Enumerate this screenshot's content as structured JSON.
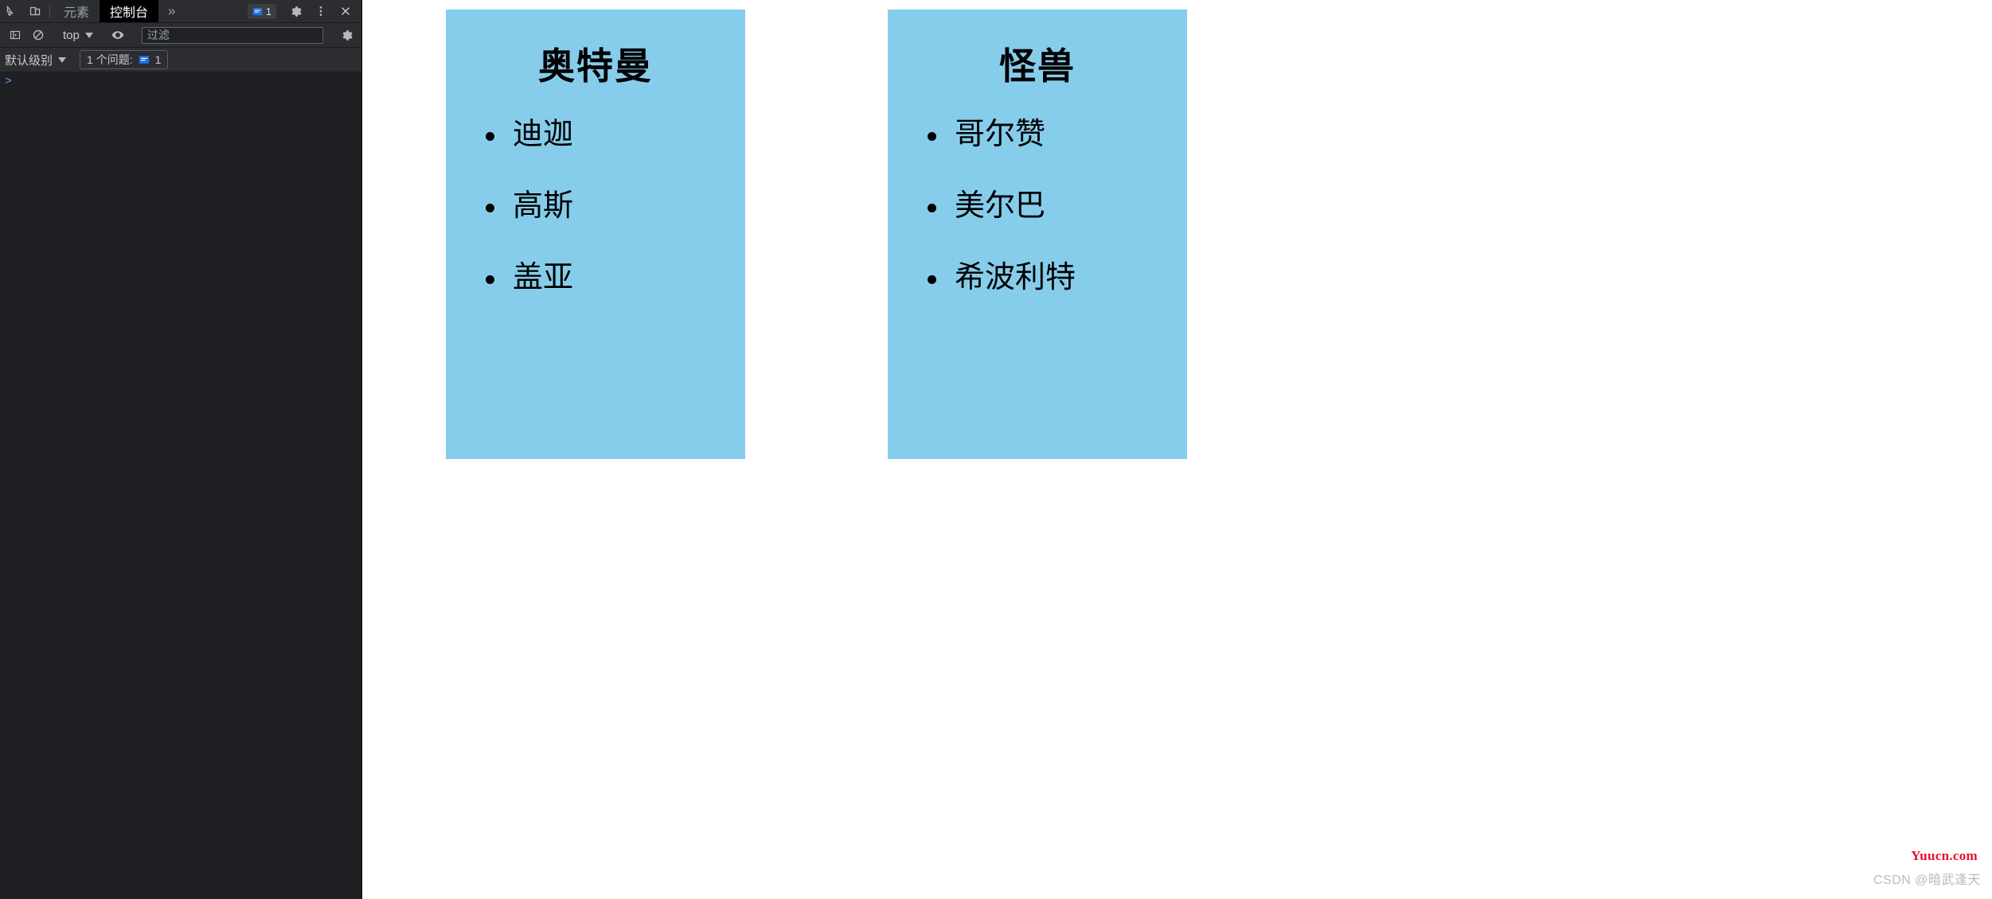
{
  "devtools": {
    "toolbar": {
      "inspect_icon": "inspect-element-icon",
      "device_icon": "device-toolbar-icon",
      "tabs": [
        {
          "label": "元素",
          "active": false
        },
        {
          "label": "控制台",
          "active": true
        }
      ],
      "more_tabs_glyph": "»",
      "issues_count": "1",
      "issues_icon": "issue-message-icon",
      "settings_icon": "gear-icon",
      "kebab_icon": "more-options-icon",
      "close_icon": "close-icon"
    },
    "console_toolbar": {
      "sidebar_icon": "console-sidebar-icon",
      "clear_icon": "clear-console-icon",
      "context_label": "top",
      "eye_icon": "live-expression-eye-icon",
      "filter_placeholder": "过滤",
      "filter_value": "",
      "settings_icon": "console-settings-gear-icon"
    },
    "level_bar": {
      "level_label": "默认级别",
      "issues_text": "1 个问题:",
      "issues_badge_icon": "issue-message-icon",
      "issues_badge_count": "1"
    },
    "console_output": {
      "prompt_glyph": ">"
    }
  },
  "page": {
    "cards": [
      {
        "title": "奥特曼",
        "items": [
          "迪迦",
          "高斯",
          "盖亚"
        ]
      },
      {
        "title": "怪兽",
        "items": [
          "哥尔赞",
          "美尔巴",
          "希波利特"
        ]
      }
    ],
    "watermarks": {
      "brand": "Yuucn.com",
      "csdn": "CSDN @暗武逢天"
    },
    "colors": {
      "card_background": "#86cdeb",
      "brand_red": "#e8112d",
      "devtools_background": "#2b2d31"
    }
  }
}
